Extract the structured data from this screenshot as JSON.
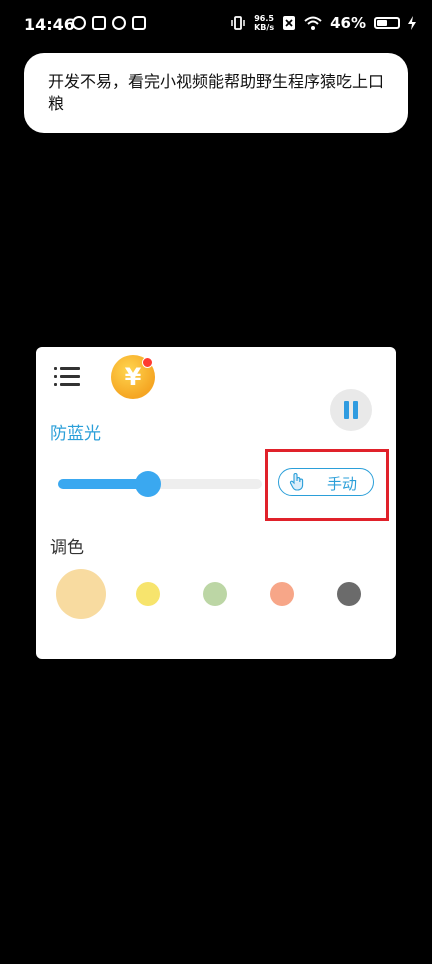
{
  "status_bar": {
    "time": "14:46",
    "net_speed_value": "96.5",
    "net_speed_unit": "KB/s",
    "battery_percent": "46%"
  },
  "toast": {
    "message": "开发不易，看完小视频能帮助野生程序猿吃上口粮"
  },
  "panel": {
    "coin_symbol": "¥",
    "blue_light_label": "防蓝光",
    "slider_level_percent": 44,
    "manual_button_label": "手动",
    "color_label": "调色",
    "swatches": [
      {
        "color": "#f8dba0",
        "selected": true
      },
      {
        "color": "#f7e46d",
        "selected": false
      },
      {
        "color": "#bcd6a5",
        "selected": false
      },
      {
        "color": "#f7a688",
        "selected": false
      },
      {
        "color": "#6b6b6b",
        "selected": false
      }
    ],
    "accent_color": "#2b9fd9",
    "highlight_color": "#e0212a"
  }
}
